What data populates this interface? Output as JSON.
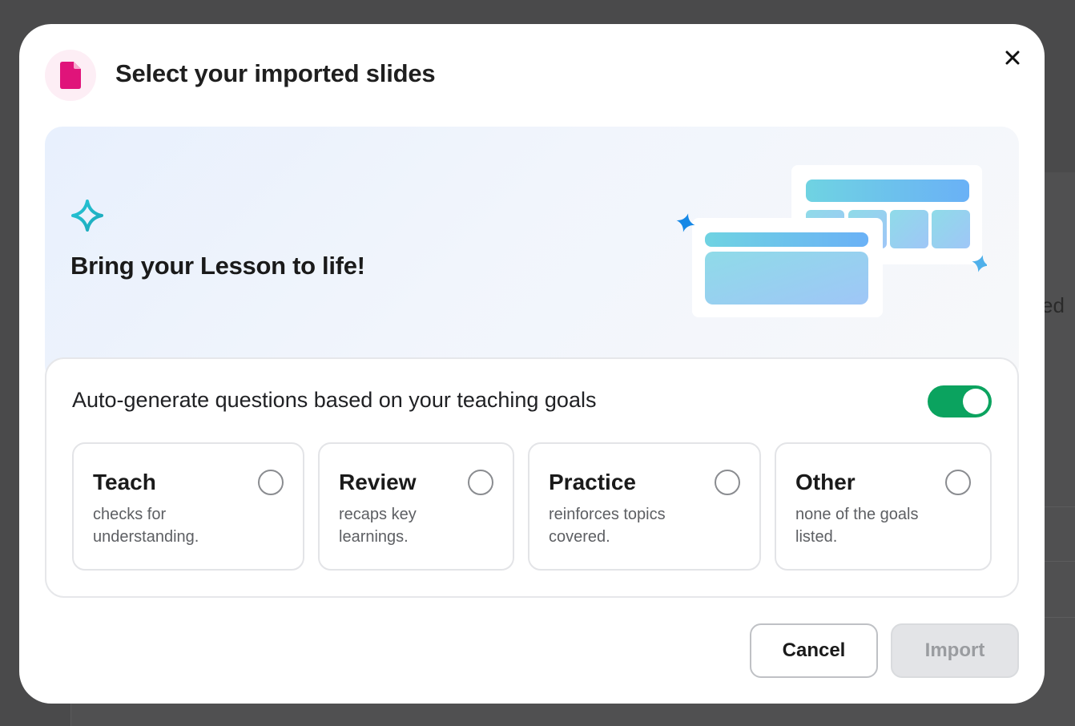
{
  "background": {
    "peek_text": "ed"
  },
  "dialog": {
    "title": "Select your imported slides",
    "header_icon": "document-icon",
    "close_icon": "close-icon",
    "accent_color": "#e0147a"
  },
  "hero": {
    "title": "Bring your Lesson to life!",
    "sparkle_icon": "sparkle-icon",
    "illustration": "slides-illustration"
  },
  "goals": {
    "label": "Auto-generate questions based on your teaching goals",
    "toggle_on": true,
    "toggle_color": "#0ba35f",
    "options": [
      {
        "title": "Teach",
        "description": "checks for understanding.",
        "selected": false
      },
      {
        "title": "Review",
        "description": "recaps key learnings.",
        "selected": false
      },
      {
        "title": "Practice",
        "description": "reinforces topics covered.",
        "selected": false
      },
      {
        "title": "Other",
        "description": "none of the goals listed.",
        "selected": false
      }
    ]
  },
  "actions": {
    "cancel_label": "Cancel",
    "import_label": "Import",
    "import_disabled": true
  }
}
